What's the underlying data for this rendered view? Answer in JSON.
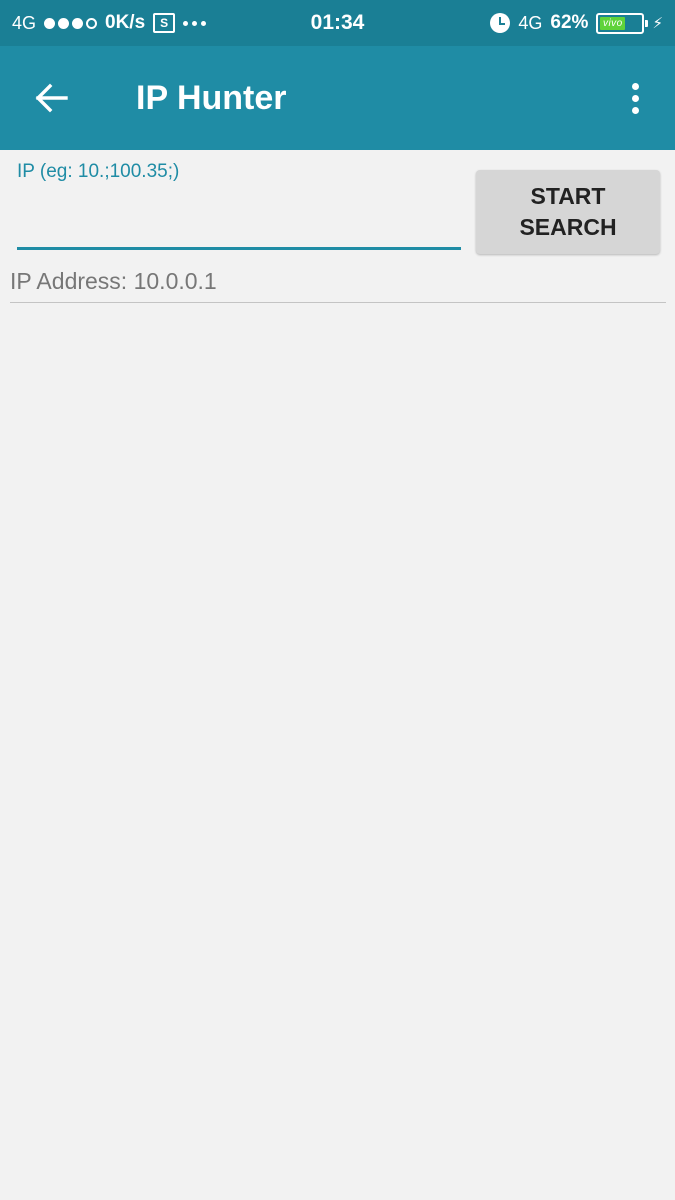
{
  "status_bar": {
    "network_left": "4G",
    "speed": "0K/s",
    "s_icon_label": "S",
    "time": "01:34",
    "network_right": "4G",
    "battery_percent": "62%",
    "battery_brand": "vivo",
    "battery_level": 0.62
  },
  "app_bar": {
    "title": "IP Hunter",
    "color": "#1f8ca5"
  },
  "form": {
    "ip_label": "IP (eg: 10.;100.35;)",
    "ip_value": "",
    "start_button_label": "START\nSEARCH"
  },
  "results": [
    {
      "text": "IP Address: 10.0.0.1"
    }
  ]
}
